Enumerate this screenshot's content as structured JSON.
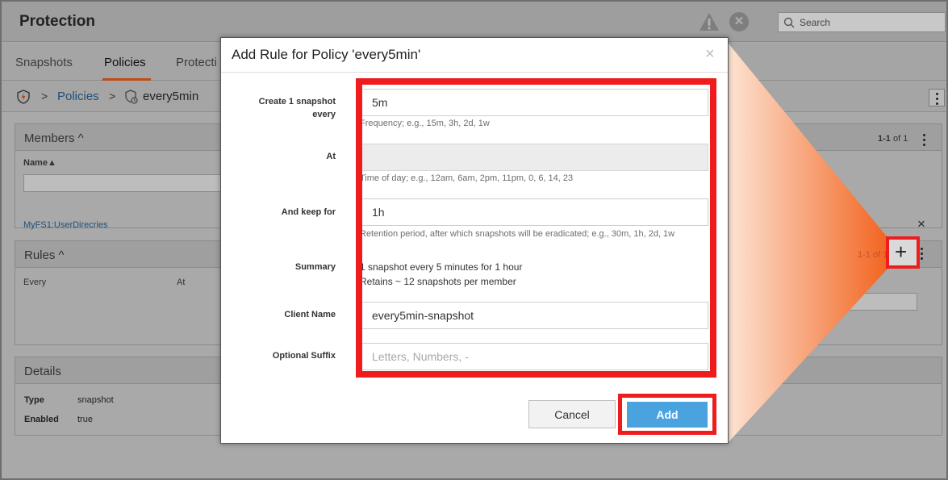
{
  "app": {
    "title": "Protection",
    "search_placeholder": "Search"
  },
  "tabs": [
    {
      "label": "Snapshots"
    },
    {
      "label": "Policies"
    },
    {
      "label": "Protecti"
    }
  ],
  "breadcrumb": {
    "sep": ">",
    "link": "Policies",
    "current": "every5min"
  },
  "members": {
    "title": "Members ^",
    "pager_bold": "1-1",
    "pager_rest": " of 1",
    "column": "Name▲",
    "row": "MyFS1:UserDirecries",
    "remove": "×"
  },
  "rules": {
    "title": "Rules ^",
    "col_every": "Every",
    "col_at": "At",
    "pager": "1-1 of 1",
    "add": "+"
  },
  "details": {
    "title": "Details",
    "rows": [
      {
        "label": "Type",
        "value": "snapshot"
      },
      {
        "label": "Enabled",
        "value": "true"
      }
    ]
  },
  "dialog": {
    "title": "Add Rule for Policy 'every5min'",
    "close": "×",
    "create_label_1": "Create 1 snapshot",
    "create_label_2": "every",
    "create_value": "5m",
    "create_hint": "Frequency; e.g., 15m, 3h, 2d, 1w",
    "at_label": "At",
    "at_hint": "Time of day; e.g., 12am, 6am, 2pm, 11pm, 0, 6, 14, 23",
    "keep_label": "And keep for",
    "keep_value": "1h",
    "keep_hint": "Retention period, after which snapshots will be eradicated; e.g., 30m, 1h, 2d, 1w",
    "summary_label": "Summary",
    "summary_line1": "1 snapshot every 5 minutes for 1 hour",
    "summary_line2": "Retains ~ 12 snapshots per member",
    "client_label": "Client Name",
    "client_value": "every5min-snapshot",
    "suffix_label": "Optional Suffix",
    "suffix_placeholder": "Letters, Numbers, -",
    "cancel": "Cancel",
    "add": "Add"
  },
  "colors": {
    "accent": "#c04a12",
    "highlight": "#ee1c1c",
    "add_button": "#4aa3df",
    "link": "#1f4f79"
  }
}
